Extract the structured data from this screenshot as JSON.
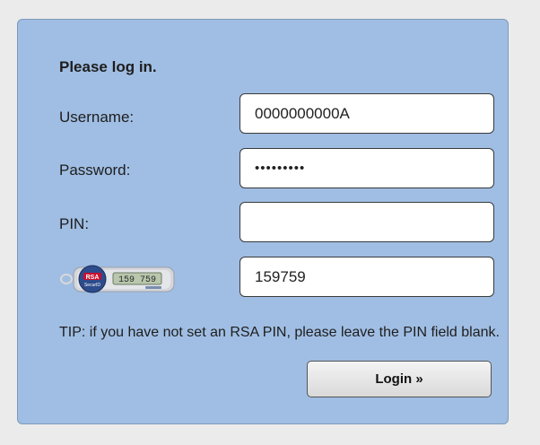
{
  "form": {
    "heading": "Please log in.",
    "username_label": "Username:",
    "username_value": "0000000000A",
    "password_label": "Password:",
    "password_value": "•••••••••",
    "pin_label": "PIN:",
    "pin_value": "",
    "token_value": "159759",
    "tip": "TIP: if you have not set an RSA PIN, please leave the PIN field blank.",
    "login_label": "Login »"
  },
  "token_image": {
    "brand": "RSA",
    "product": "SecurID",
    "display": "159 759",
    "icon": "rsa-securid-token-icon"
  },
  "colors": {
    "panel": "#a0bee3",
    "page": "#ebebeb",
    "rsa_red": "#c8102e"
  }
}
